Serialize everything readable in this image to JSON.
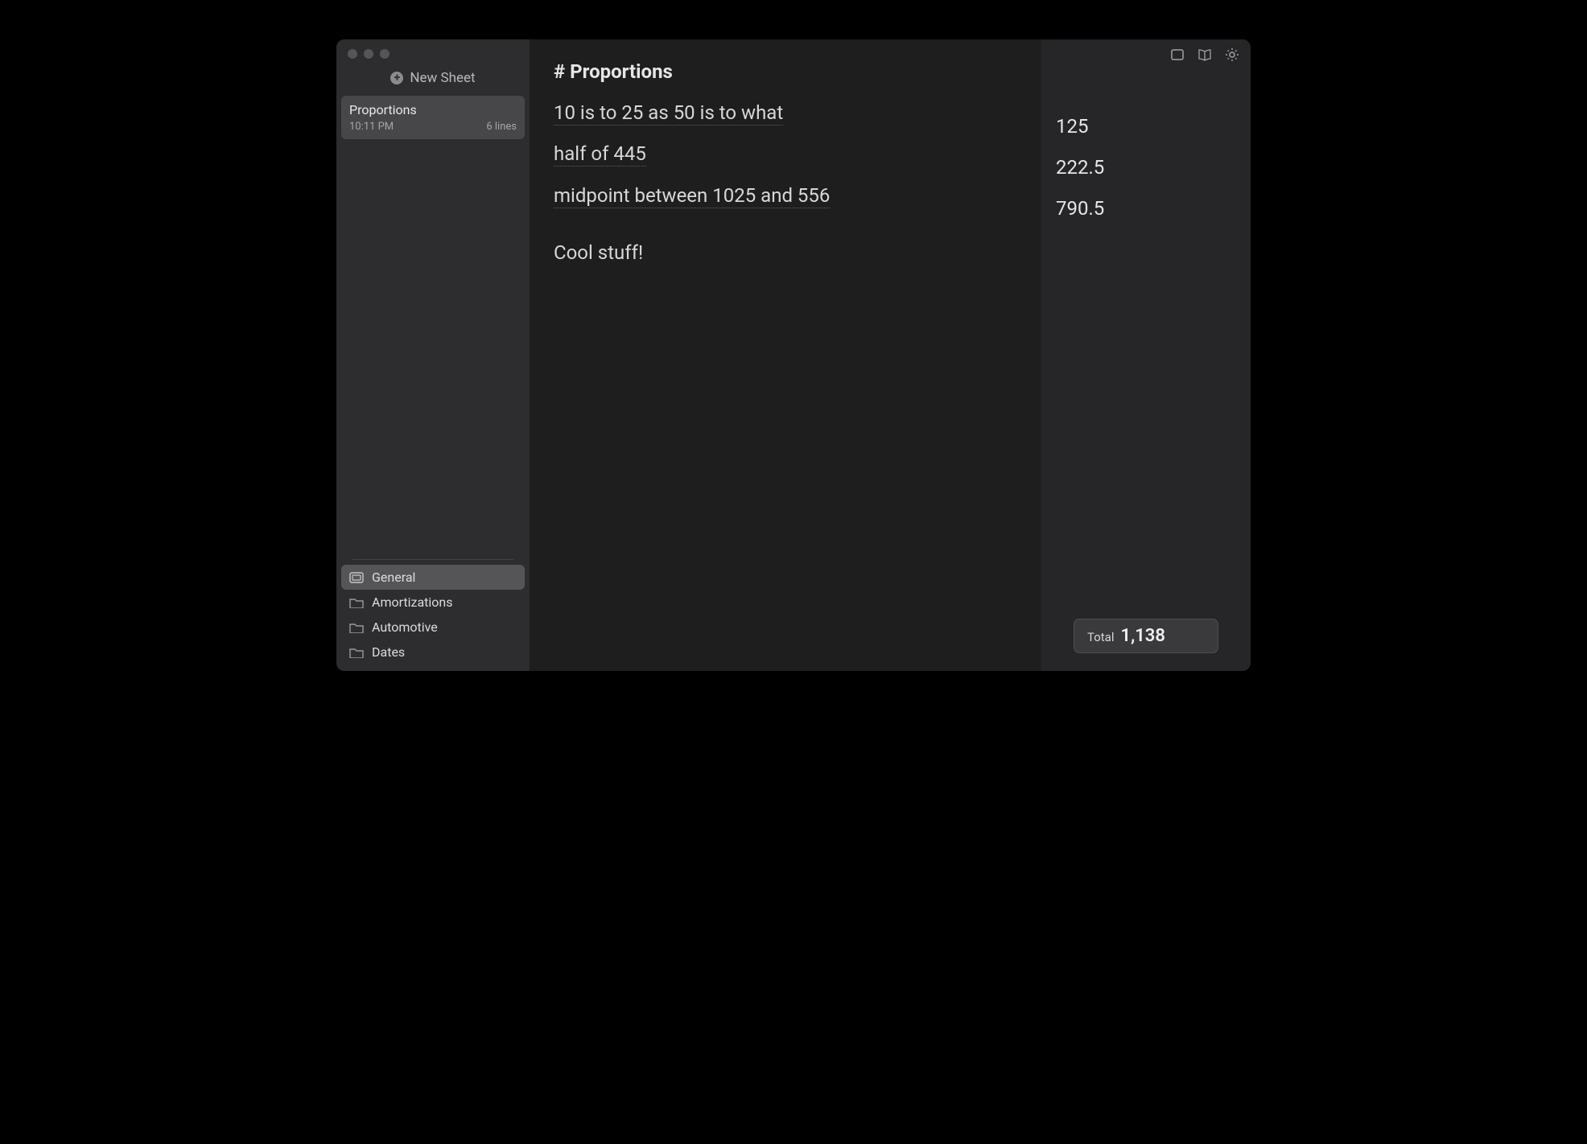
{
  "sidebar": {
    "new_sheet_label": "New Sheet",
    "sheets": [
      {
        "title": "Proportions",
        "time": "10:11 PM",
        "lines": "6 lines"
      }
    ],
    "folders": [
      {
        "label": "General",
        "selected": true,
        "icon": "stack"
      },
      {
        "label": "Amortizations",
        "selected": false,
        "icon": "folder"
      },
      {
        "label": "Automotive",
        "selected": false,
        "icon": "folder"
      },
      {
        "label": "Dates",
        "selected": false,
        "icon": "folder"
      }
    ]
  },
  "editor": {
    "heading": "# Proportions",
    "lines": [
      {
        "text": "10 is to 25 as 50 is to what",
        "result": "125"
      },
      {
        "text": "half of 445",
        "result": "222.5"
      },
      {
        "text": "midpoint between 1025 and 556",
        "result": "790.5"
      }
    ],
    "comment": "Cool stuff!"
  },
  "total": {
    "label": "Total",
    "value": "1,138"
  }
}
